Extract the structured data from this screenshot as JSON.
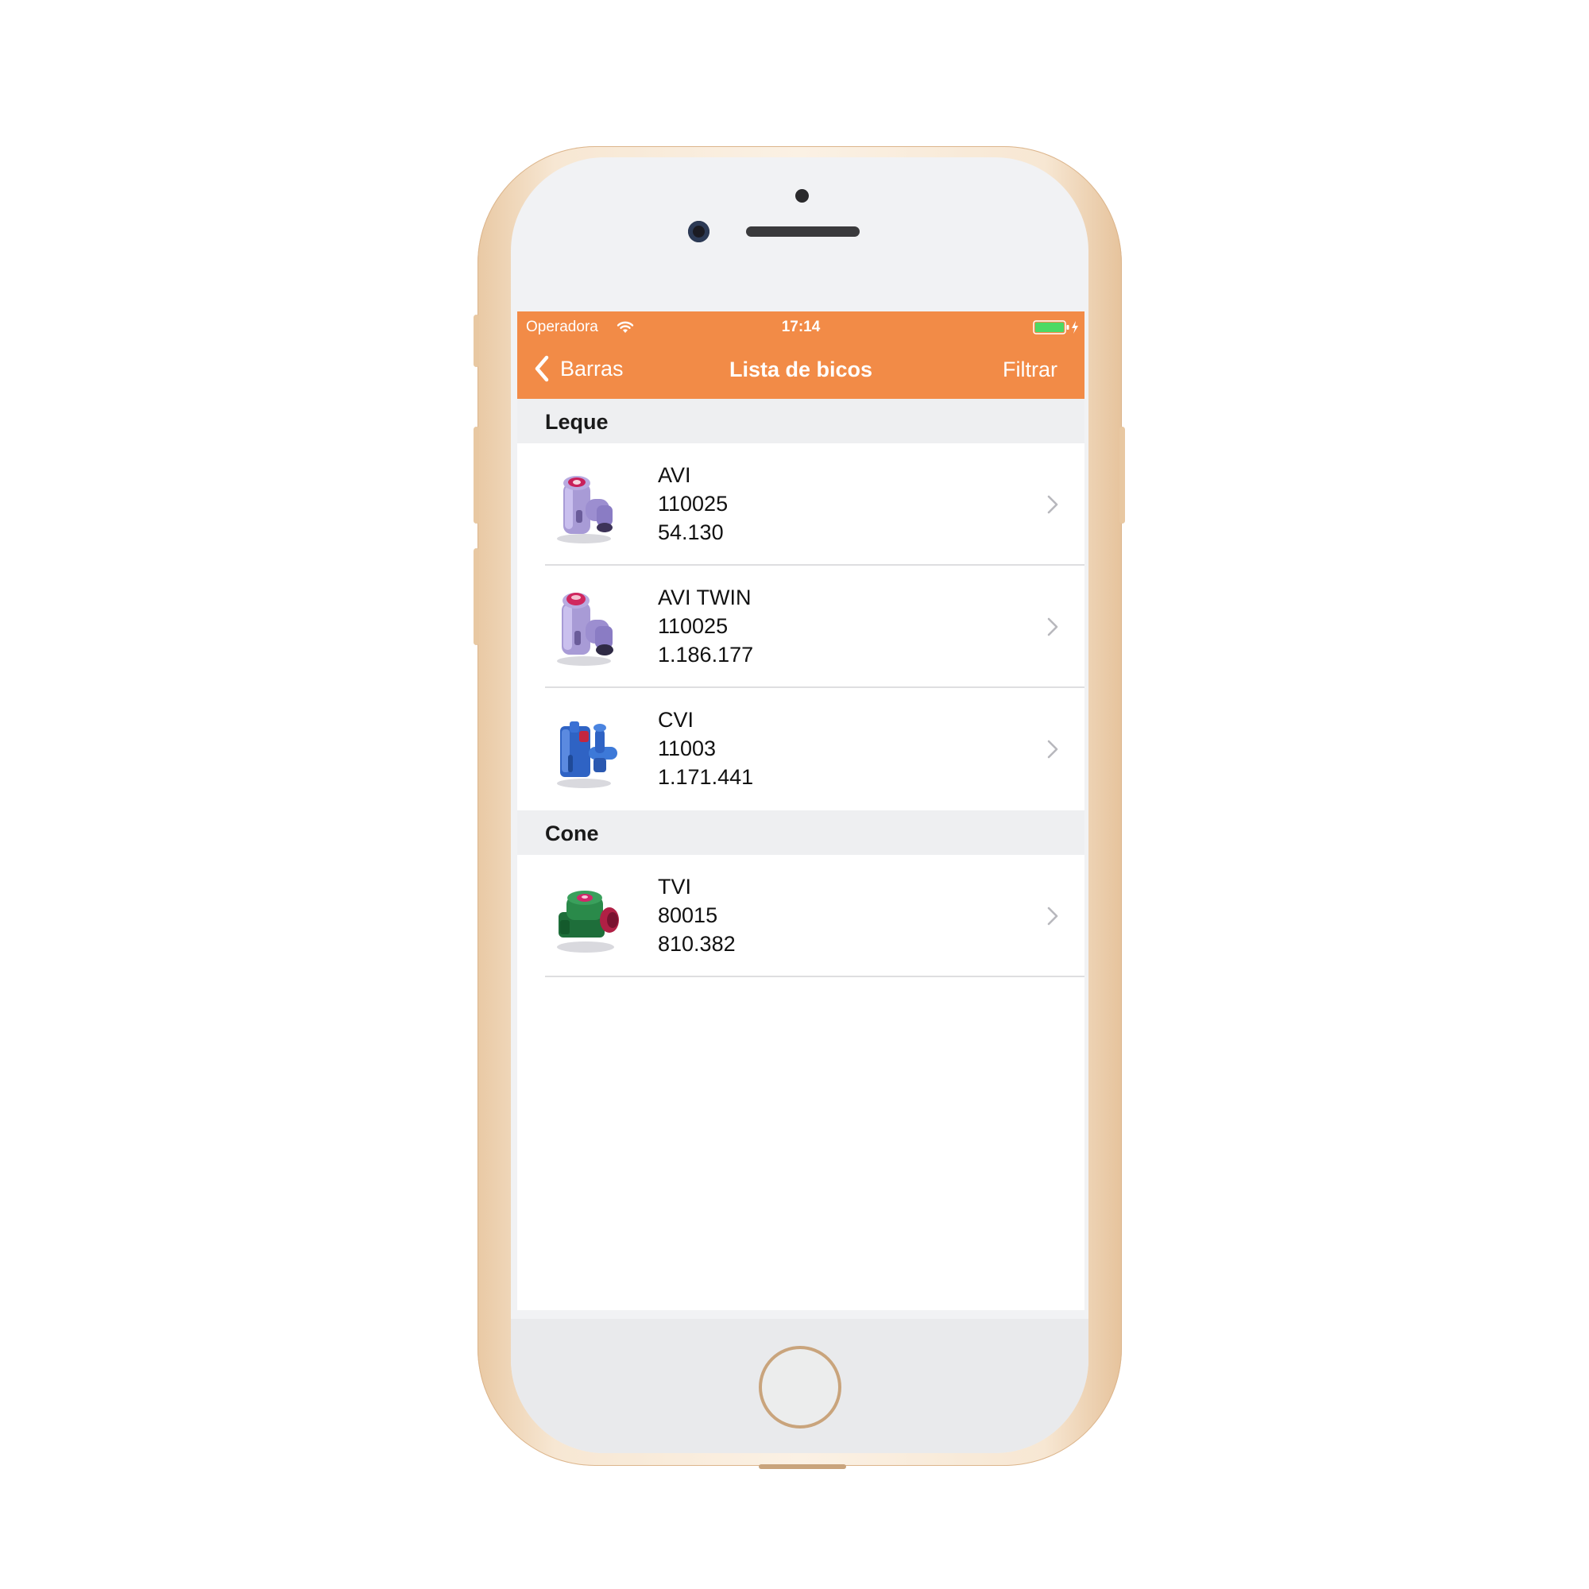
{
  "status_bar": {
    "carrier": "Operadora",
    "time": "17:14"
  },
  "nav_bar": {
    "back_label": "Barras",
    "title": "Lista de bicos",
    "action_label": "Filtrar",
    "accent_color": "#f28b47"
  },
  "sections": [
    {
      "title": "Leque",
      "items": [
        {
          "name": "AVI",
          "code": "110025",
          "number": "54.130",
          "icon": "purple-nozzle-icon"
        },
        {
          "name": "AVI TWIN",
          "code": "110025",
          "number": "1.186.177",
          "icon": "purple-twin-nozzle-icon"
        },
        {
          "name": "CVI",
          "code": "11003",
          "number": "1.171.441",
          "icon": "blue-nozzle-icon"
        }
      ]
    },
    {
      "title": "Cone",
      "items": [
        {
          "name": "TVI",
          "code": "80015",
          "number": "810.382",
          "icon": "green-nozzle-icon"
        }
      ]
    }
  ]
}
